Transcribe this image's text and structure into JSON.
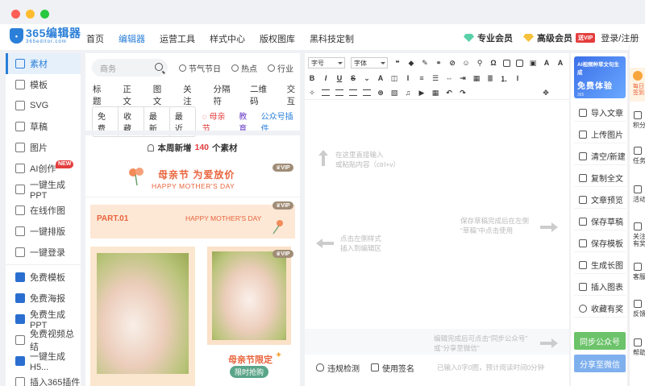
{
  "app": {
    "logo_title": "365编辑器",
    "logo_sub": "365editor.com"
  },
  "nav": {
    "links": [
      "首页",
      "编辑器",
      "运营工具",
      "样式中心",
      "版权图库",
      "黑科技定制"
    ],
    "active": "编辑器",
    "pro_member": "专业会员",
    "senior_member": "高级会员",
    "vip_badge": "送VIP",
    "login": "登录/注册"
  },
  "sidebar": {
    "items": [
      {
        "label": "素材",
        "icon": "material-icon"
      },
      {
        "label": "模板",
        "icon": "template-icon"
      },
      {
        "label": "SVG",
        "icon": "svg-icon"
      },
      {
        "label": "草稿",
        "icon": "draft-icon"
      },
      {
        "label": "图片",
        "icon": "image-icon"
      },
      {
        "label": "AI创作",
        "icon": "ai-icon"
      },
      {
        "label": "一键生成PPT",
        "icon": "ppt-icon"
      },
      {
        "label": "在线作图",
        "icon": "draw-icon"
      },
      {
        "label": "一键排版",
        "icon": "layout-icon"
      },
      {
        "label": "一键登录",
        "icon": "login-icon"
      },
      {
        "label": "免费模板",
        "icon": "free-template-icon"
      },
      {
        "label": "免费海报",
        "icon": "poster-icon"
      },
      {
        "label": "免费生成PPT",
        "icon": "ai-ppt-icon"
      },
      {
        "label": "免费视频总结",
        "icon": "video-icon"
      },
      {
        "label": "一键生成H5...",
        "icon": "h5-icon"
      },
      {
        "label": "插入365插件",
        "icon": "plugin-icon"
      }
    ],
    "new_badge": "NEW"
  },
  "panel": {
    "search_placeholder": "商务",
    "quick": [
      "节气节日",
      "热点",
      "行业"
    ],
    "categories": [
      "标题",
      "正文",
      "图文",
      "关注",
      "分隔符",
      "二维码",
      "交互"
    ],
    "filters": [
      "免费",
      "收藏",
      "最新",
      "最近"
    ],
    "tag_mother": "母亲节",
    "tag_edu": "教育",
    "tag_plugin": "公众号插件",
    "new_prefix": "本周新增",
    "new_count": "140",
    "new_suffix": "个素材",
    "vip_label": "VIP",
    "card1_title": "母亲节 为爱放价",
    "card1_sub": "HAPPY MOTHER'S DAY",
    "card2_part": "PART.01",
    "card2_hmd": "HAPPY MOTHER'S DAY",
    "card4_title": "母亲节限定",
    "card4_btn": "限时抢购"
  },
  "editor": {
    "toolbar": {
      "font_size_label": "字号",
      "font_family_label": "字体"
    },
    "hint_top": "在这里直接输入\n或粘贴内容（ctrl+v）",
    "hint_left": "点击左侧样式\n插入到编辑区",
    "hint_right": "保存草稿完成后在左侧\n“草稿”中点击使用",
    "hint_sync": "编辑完成后可点击“同步公众号”\n或“分享至微信”",
    "violation_check": "违规检测",
    "use_signature": "使用签名",
    "word_count": "已输入0字0图，预计阅读时间0分钟"
  },
  "tools": {
    "promo_line1": "AI视频种草文句生成",
    "promo_line2": "免费体验",
    "promo_line3": "365",
    "items": [
      "导入文章",
      "上传图片",
      "清空/新建",
      "复制全文",
      "文章预览",
      "保存草稿",
      "保存模板",
      "生成长图",
      "插入图表",
      "收藏有奖"
    ],
    "sync_button": "同步公众号",
    "share_button": "分享至微信"
  },
  "strip": {
    "top": "每日签到",
    "items": [
      "积分",
      "任务",
      "活动",
      "关注有奖",
      "客服",
      "反馈",
      "帮助"
    ]
  },
  "colors": {
    "accent": "#2a7fd8",
    "mother": "#e43d3d",
    "edu": "#6a3fc8",
    "sync_green": "#6cc36a",
    "share_blue": "#7fb0ee"
  }
}
